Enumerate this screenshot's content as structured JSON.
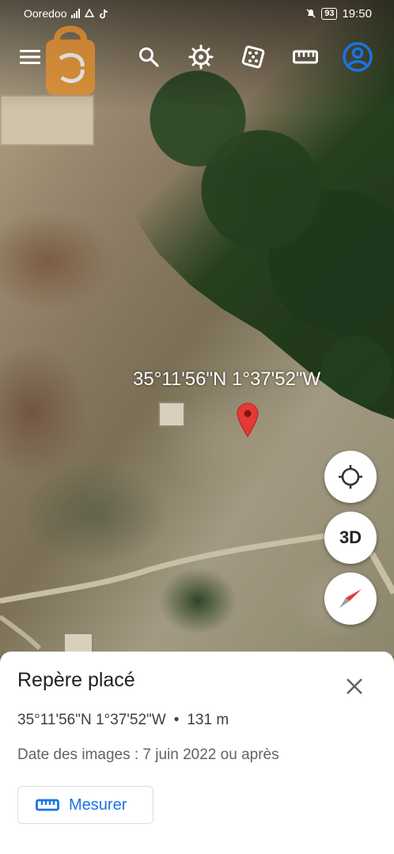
{
  "status_bar": {
    "carrier": "Ooredoo",
    "battery": "93",
    "time": "19:50",
    "icons": [
      "signal-icon",
      "data-saver-icon",
      "tiktok-icon",
      "mute-icon",
      "battery-icon"
    ]
  },
  "toolbar": {
    "icons": [
      "menu-icon",
      "search-icon",
      "voyager-icon",
      "feeling-lucky-icon",
      "measure-icon",
      "account-icon"
    ]
  },
  "map": {
    "coordinate_label": "35°11'56\"N 1°37'52\"W"
  },
  "fabs": {
    "three_d_label": "3D",
    "icons": [
      "my-location-icon",
      "compass-icon"
    ]
  },
  "sheet": {
    "title": "Repère placé",
    "coordinates": "35°11'56\"N 1°37'52\"W",
    "separator": "•",
    "altitude": "131 m",
    "date": "Date des images : 7 juin 2022 ou après",
    "measure_label": "Mesurer"
  },
  "colors": {
    "accent": "#1a73e8",
    "pin": "#e53935",
    "watermark": "#e8902a"
  }
}
